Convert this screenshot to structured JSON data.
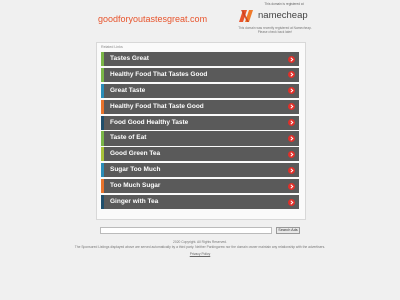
{
  "header": {
    "domain": "goodforyoutastesgreat.com",
    "registered_line": "This domain is registered at",
    "brand_name": "namecheap",
    "brand_note": "This domain was recently registered at Namecheap. Please check back later!",
    "brand_color": "#e8542c"
  },
  "panel": {
    "heading": "Related Links",
    "links": [
      {
        "label": "Tastes Great",
        "accent": "#7ab648"
      },
      {
        "label": "Healthy Food That Tastes Good",
        "accent": "#7ab648"
      },
      {
        "label": "Great Taste",
        "accent": "#2a8db8"
      },
      {
        "label": "Healthy Food That Taste Good",
        "accent": "#e8732c"
      },
      {
        "label": "Food Good Healthy Taste",
        "accent": "#1f4e6b"
      },
      {
        "label": "Taste of Eat",
        "accent": "#7ab648"
      },
      {
        "label": "Good Green Tea",
        "accent": "#a8c23a"
      },
      {
        "label": "Sugar Too Much",
        "accent": "#2a8db8"
      },
      {
        "label": "Too Much Sugar",
        "accent": "#e8732c"
      },
      {
        "label": "Ginger with Tea",
        "accent": "#1f4e6b"
      }
    ],
    "arrow_icon": "arrow-right-icon",
    "arrow_color": "#e0302a"
  },
  "search": {
    "placeholder": "",
    "button_label": "Search Ads"
  },
  "footer": {
    "copyright": "2020 Copyright. All Rights Reserved.",
    "disclaimer": "The Sponsored Listings displayed above are served automatically by a third party. Neither Parkingcrew nor the domain owner maintain any relationship with the advertisers.",
    "privacy_label": "Privacy Policy"
  }
}
